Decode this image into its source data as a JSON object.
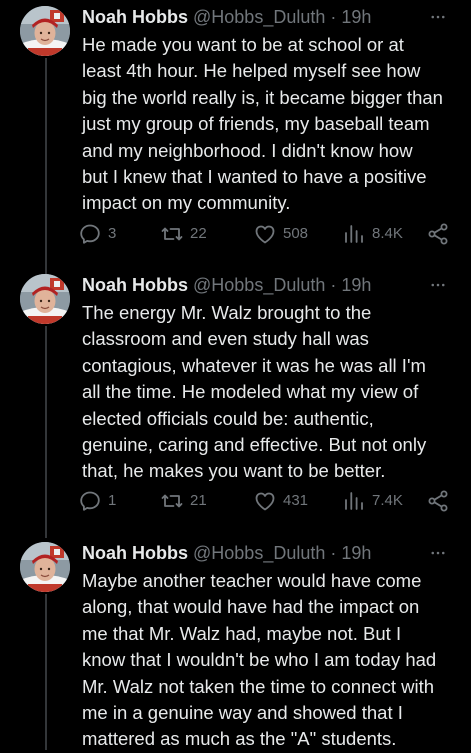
{
  "colors": {
    "background": "#000000",
    "primary_text": "#e7e9ea",
    "secondary_text": "#71767b",
    "thread_line": "#333639"
  },
  "icons": {
    "reply": "reply-icon",
    "repost": "repost-icon",
    "like": "heart-icon",
    "views": "views-bar-chart-icon",
    "share": "share-icon",
    "more": "more-options-icon"
  },
  "tweets": [
    {
      "author_name": "Noah Hobbs",
      "author_handle": "@Hobbs_Duluth",
      "separator": "·",
      "time": "19h",
      "text": "He made you want to be at school or at\nleast 4th hour. He helped myself see how\nbig the world really is, it became bigger than\njust my group of friends, my baseball team\nand my neighborhood. I didn't know how\nbut I knew that I wanted to have a positive\nimpact on my community.",
      "replies": "3",
      "reposts": "22",
      "likes": "508",
      "views": "8.4K"
    },
    {
      "author_name": "Noah Hobbs",
      "author_handle": "@Hobbs_Duluth",
      "separator": "·",
      "time": "19h",
      "text": "The energy Mr. Walz brought to the\nclassroom and even study hall was\ncontagious, whatever it was he was all I'm\nall the time. He modeled what my view of\nelected officials could be: authentic,\ngenuine, caring and effective. But not only\nthat, he makes you want to be better.",
      "replies": "1",
      "reposts": "21",
      "likes": "431",
      "views": "7.4K"
    },
    {
      "author_name": "Noah Hobbs",
      "author_handle": "@Hobbs_Duluth",
      "separator": "·",
      "time": "19h",
      "text": "Maybe another teacher would have come\nalong, that would have had the impact on\nme that Mr. Walz had, maybe not. But I\nknow that I wouldn't be who I am today had\nMr. Walz not taken the time to connect with\nme in a genuine way and showed that I\nmattered as much as the \"A\" students."
    }
  ]
}
